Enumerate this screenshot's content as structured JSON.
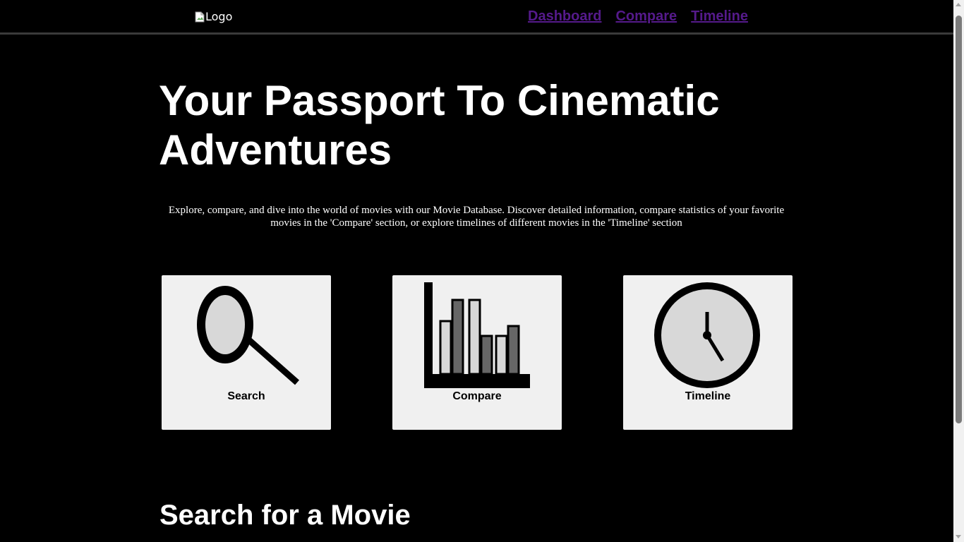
{
  "header": {
    "logo_alt": "Logo",
    "nav": {
      "dashboard": "Dashboard",
      "compare": "Compare",
      "timeline": "Timeline"
    },
    "link_color": "#551a8b"
  },
  "hero": {
    "title": "Your Passport To Cinematic Adventures",
    "description": "Explore, compare, and dive into the world of movies with our Movie Database. Discover detailed information, compare statistics of your favorite movies in the 'Compare' section, or explore timelines of different movies in the 'Timeline' section"
  },
  "cards": {
    "search": {
      "label": "Search",
      "icon": "magnifying-glass-icon"
    },
    "compare": {
      "label": "Compare",
      "icon": "bar-chart-icon"
    },
    "timeline": {
      "label": "Timeline",
      "icon": "clock-icon"
    }
  },
  "search_section": {
    "title": "Search for a Movie"
  },
  "colors": {
    "background": "#000000",
    "card_background": "#f0f0f0",
    "text": "#ffffff"
  }
}
